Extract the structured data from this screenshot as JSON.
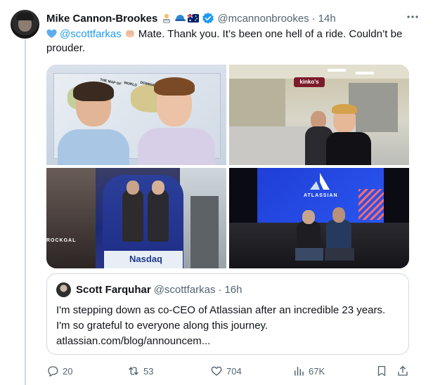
{
  "tweet": {
    "author_name": "Mike Cannon-Brookes",
    "author_handle": "@mcannonbrookes",
    "separator": "·",
    "time": "14h",
    "mention": "@scottfarkas",
    "text": "Mate. Thank you. It’s been one hell of a ride. Couldn’t be prouder.",
    "emojis": [
      "technologist-emoji",
      "cap-emoji",
      "australia-flag-emoji"
    ]
  },
  "media": {
    "photos": [
      {
        "label": "photo-1",
        "sign_text": [
          "THE MAP OF",
          "WORLD",
          "DOMINATION"
        ]
      },
      {
        "label": "photo-2",
        "sign_text": "kinko's"
      },
      {
        "label": "photo-3",
        "sign_text": [
          "ROCKGAL",
          "Nasdaq"
        ]
      },
      {
        "label": "photo-4",
        "sign_text": "ATLASSIAN"
      }
    ]
  },
  "quote": {
    "author_name": "Scott Farquhar",
    "author_handle": "@scottfarkas",
    "separator": "·",
    "time": "16h",
    "line1": "I'm stepping down as co-CEO of Atlassian after an incredible 23 years.",
    "line2": "I'm so grateful to everyone along this journey.",
    "line3": "atlassian.com/blog/announcem..."
  },
  "actions": {
    "replies": "20",
    "reposts": "53",
    "likes": "704",
    "views": "67K"
  },
  "colors": {
    "accent": "#1d9bf0",
    "secondary_text": "#536471",
    "border": "#cfd9de"
  }
}
